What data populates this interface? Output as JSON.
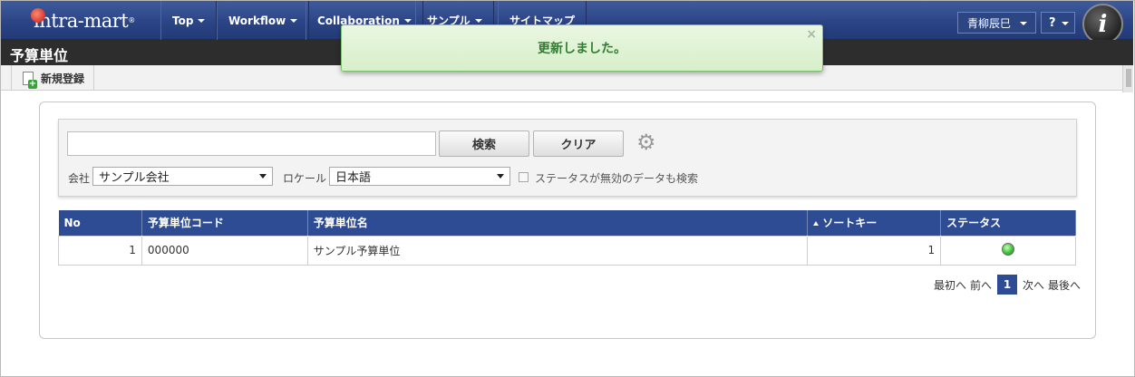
{
  "app": {
    "logo_text": "intra-mart",
    "logo_mark": "®"
  },
  "nav": {
    "items": [
      {
        "label": "Top"
      },
      {
        "label": "Workflow"
      },
      {
        "label": "Collaboration"
      },
      {
        "label": "サンプル"
      },
      {
        "label": "サイトマップ"
      }
    ],
    "user_name": "青柳辰巳",
    "help_label": "?"
  },
  "page": {
    "title": "予算単位"
  },
  "toolbar": {
    "new_label": "新規登録"
  },
  "toast": {
    "message": "更新しました。",
    "close": "×"
  },
  "search": {
    "input_value": "",
    "search_button": "検索",
    "clear_button": "クリア",
    "company_label": "会社",
    "company_value": "サンプル会社",
    "locale_label": "ロケール",
    "locale_value": "日本語",
    "include_inactive_label": "ステータスが無効のデータも検索",
    "include_inactive_checked": false
  },
  "table": {
    "columns": [
      "No",
      "予算単位コード",
      "予算単位名",
      "ソートキー",
      "ステータス"
    ],
    "rows": [
      {
        "no": "1",
        "code": "000000",
        "name": "サンプル予算単位",
        "sort_key": "1",
        "status": "active"
      }
    ]
  },
  "pager": {
    "first": "最初へ",
    "prev": "前へ",
    "current": "1",
    "next": "次へ",
    "last": "最後へ"
  },
  "colors": {
    "nav_bg": "#2a4384",
    "header_bg": "#2d4c94",
    "toast_text": "#2f7d2f",
    "status_active": "#3ec33a"
  }
}
